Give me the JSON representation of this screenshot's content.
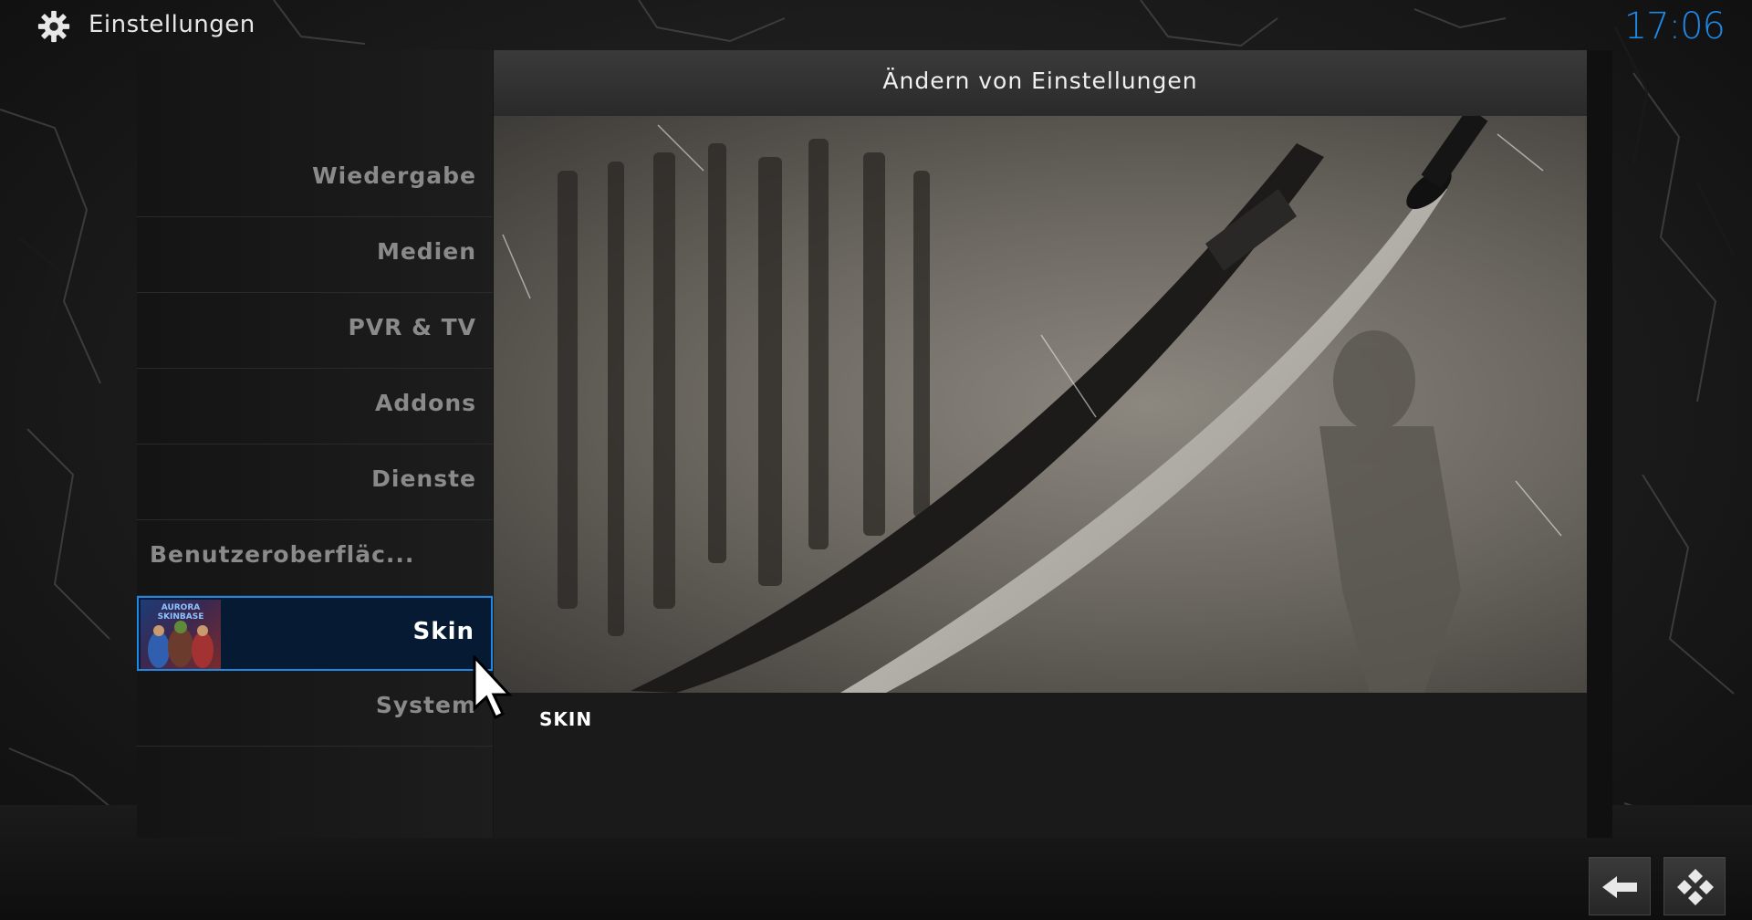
{
  "header": {
    "title": "Einstellungen",
    "clock": "17:06",
    "icon": "gear-icon"
  },
  "sidebar": {
    "items": [
      {
        "label": "Wiedergabe"
      },
      {
        "label": "Medien"
      },
      {
        "label": "PVR & TV"
      },
      {
        "label": "Addons"
      },
      {
        "label": "Dienste"
      },
      {
        "label": "Benutzeroberfläc..."
      },
      {
        "label": "Skin",
        "selected": true,
        "thumbnail_text": "AURORA SKINBASE"
      },
      {
        "label": "System"
      }
    ]
  },
  "content": {
    "title": "Ändern von Einstellungen",
    "info_label": "SKIN",
    "artwork": "samurai-sword-calligraphy-image"
  },
  "footer": {
    "back_icon": "back-arrow-icon",
    "kodi_icon": "kodi-logo-icon"
  },
  "colors": {
    "accent": "#1e88e5",
    "selected_bg": "#071a33"
  }
}
